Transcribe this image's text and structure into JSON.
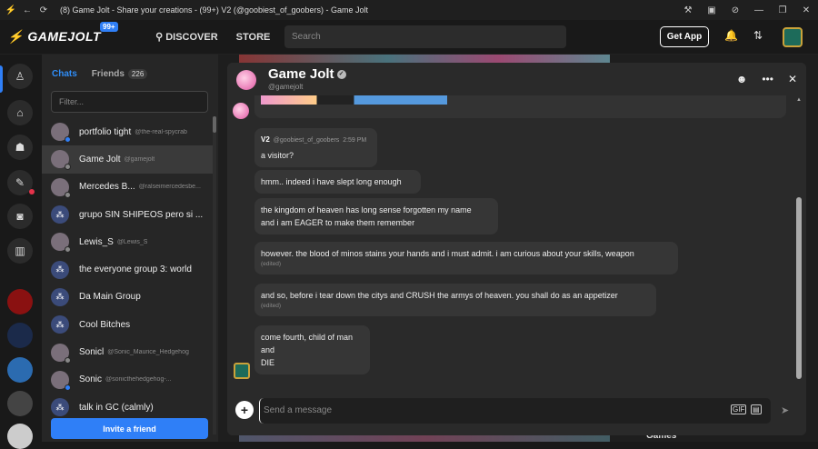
{
  "window": {
    "title": "(8) Game Jolt - Share your creations - (99+) V2 (@goobiest_of_goobers) - Game Jolt"
  },
  "topnav": {
    "logo": "GAMEJOLT",
    "badge": "99+",
    "discover": "DISCOVER",
    "store": "STORE",
    "search_placeholder": "Search",
    "get_app": "Get App"
  },
  "chatlist": {
    "tab_chats": "Chats",
    "tab_friends": "Friends",
    "friends_count": "226",
    "filter_placeholder": "Filter...",
    "invite": "Invite a friend",
    "items": [
      {
        "name": "portfolio tight",
        "handle": "@the-real-spycrab",
        "kind": "user",
        "status": "#2f7ff7"
      },
      {
        "name": "Game Jolt",
        "handle": "@gamejolt",
        "kind": "user",
        "status": "#888888"
      },
      {
        "name": "Mercedes B...",
        "handle": "@ralseimercedesbe...",
        "kind": "user",
        "status": "#888888"
      },
      {
        "name": "grupo SIN SHIPEOS pero si ...",
        "handle": "",
        "kind": "group",
        "status": ""
      },
      {
        "name": "Lewis_S",
        "handle": "@Lewis_S",
        "kind": "user",
        "status": "#888888"
      },
      {
        "name": "the everyone group 3: world",
        "handle": "",
        "kind": "group",
        "status": ""
      },
      {
        "name": "Da Main Group",
        "handle": "",
        "kind": "group",
        "status": ""
      },
      {
        "name": "Cool Bitches",
        "handle": "",
        "kind": "group",
        "status": ""
      },
      {
        "name": "Sonicl",
        "handle": "@Sonic_Maurice_Hedgehog",
        "kind": "user",
        "status": "#888888"
      },
      {
        "name": "Sonic",
        "handle": "@sonicthehedgehog-...",
        "kind": "user",
        "status": "#2f7ff7"
      },
      {
        "name": "talk in GC (calmly)",
        "handle": "",
        "kind": "group",
        "status": ""
      }
    ]
  },
  "chat": {
    "title": "Game Jolt",
    "handle": "@gamejolt",
    "sender": "V2",
    "sender_handle": "@goobiest_of_goobers",
    "time": "2:59 PM",
    "messages": [
      {
        "text": "a visitor?"
      },
      {
        "text": "hmm.. indeed i have slept long enough"
      },
      {
        "line1": "the kingdom of heaven has long sense forgotten my name",
        "line2": "and i am EAGER to make them remember"
      },
      {
        "text": "however. the blood of minos stains your hands and i must admit. i am curious about your skills, weapon",
        "edited": "(edited)"
      },
      {
        "text": "and so, before i tear down the citys and CRUSH the armys of heaven. you shall do as an appetizer",
        "edited": "(edited)"
      },
      {
        "line1": "come fourth, child of man",
        "line2": "and",
        "line3": "DIE"
      }
    ],
    "composer_placeholder": "Send a message",
    "gif_label": "GIF"
  },
  "background": {
    "games_label": "Games"
  },
  "colors": {
    "accent": "#2f7ff7",
    "panel": "#2a2a2a",
    "bubble": "#363636"
  }
}
